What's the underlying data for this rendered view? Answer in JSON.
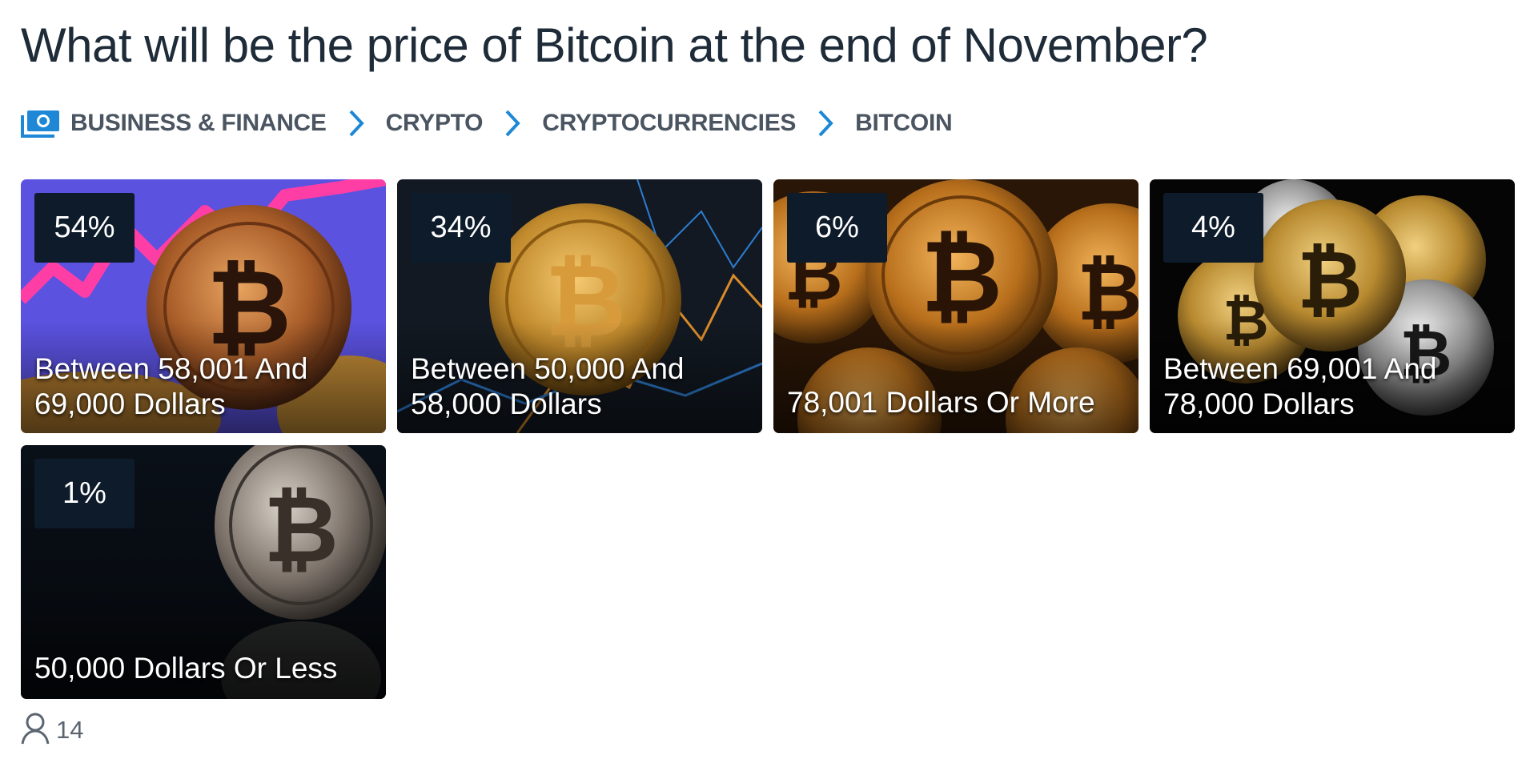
{
  "question": {
    "title": "What will be the price of Bitcoin at the end of November?"
  },
  "breadcrumb": {
    "icon": "money-icon",
    "items": [
      {
        "label": "BUSINESS & FINANCE"
      },
      {
        "label": "CRYPTO"
      },
      {
        "label": "CRYPTOCURRENCIES"
      },
      {
        "label": "BITCOIN"
      }
    ]
  },
  "options": [
    {
      "percent": "54%",
      "label": "Between 58,001 And 69,000 Dollars",
      "value": 54
    },
    {
      "percent": "34%",
      "label": "Between 50,000 And 58,000 Dollars",
      "value": 34
    },
    {
      "percent": "6%",
      "label": "78,001 Dollars Or More",
      "value": 6
    },
    {
      "percent": "4%",
      "label": "Between 69,001 And 78,000 Dollars",
      "value": 4
    },
    {
      "percent": "1%",
      "label": "50,000 Dollars Or Less",
      "value": 1
    }
  ],
  "footer": {
    "participants_icon": "user-icon",
    "participants_count": "14"
  },
  "colors": {
    "accent": "#1e88d6",
    "badge_bg": "#0d1b2a",
    "title": "#1e2b38",
    "breadcrumb_text": "#4a5561"
  }
}
